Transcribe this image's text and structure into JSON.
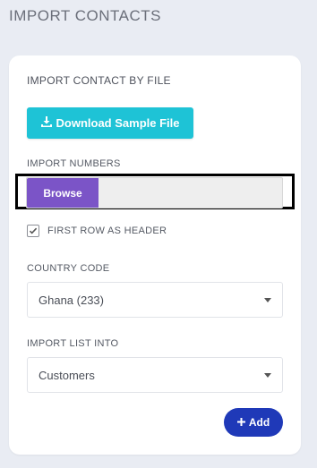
{
  "page": {
    "title": "IMPORT CONTACTS"
  },
  "card": {
    "section_title": "IMPORT CONTACT BY FILE",
    "download_button": {
      "label": "Download Sample File",
      "icon": "download-icon"
    },
    "import_numbers": {
      "label": "IMPORT NUMBERS",
      "browse_label": "Browse",
      "file_value": ""
    },
    "first_row_header": {
      "label": "FIRST ROW AS HEADER",
      "checked": true
    },
    "country_code": {
      "label": "COUNTRY CODE",
      "value": "Ghana (233)"
    },
    "import_list": {
      "label": "IMPORT LIST INTO",
      "value": "Customers"
    },
    "add_button": {
      "label": "Add",
      "icon": "plus-icon"
    }
  },
  "colors": {
    "background": "#e9ecf3",
    "download": "#1ec3d6",
    "browse": "#7b54c7",
    "add": "#1f39b8"
  }
}
